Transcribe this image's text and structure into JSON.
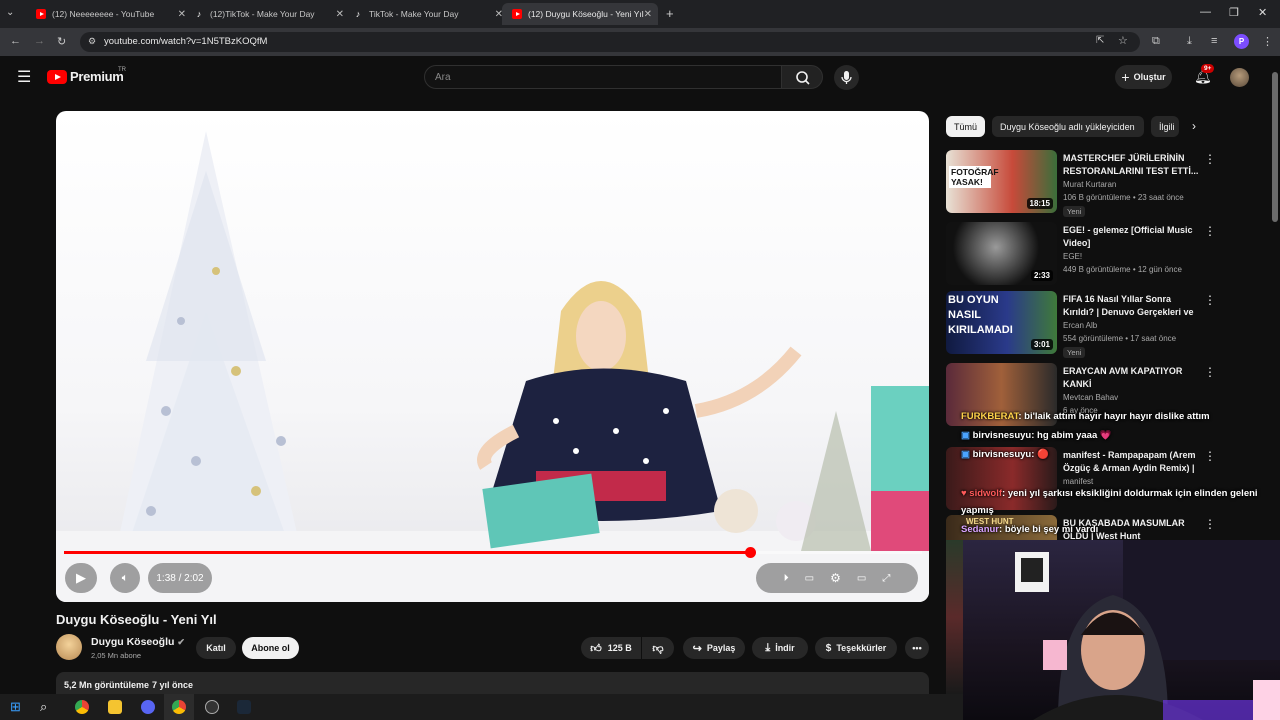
{
  "browser": {
    "tabs": [
      {
        "title": "(12) Neeeeeeee - YouTube",
        "icon": "youtube-icon",
        "active": false
      },
      {
        "title": "(12)TikTok - Make Your Day",
        "icon": "tiktok-icon",
        "active": false
      },
      {
        "title": "TikTok - Make Your Day",
        "icon": "tiktok-icon",
        "active": false
      },
      {
        "title": "(12) Duygu Köseoğlu - Yeni Yıl",
        "icon": "youtube-icon",
        "active": true
      }
    ],
    "url": "youtube.com/watch?v=1N5TBzKOQfM",
    "profile_initial": "P"
  },
  "masthead": {
    "logo_text": "Premium",
    "region": "TR",
    "search_placeholder": "Ara",
    "create_label": "Oluştur",
    "notification_count": "9+"
  },
  "player": {
    "time": "1:38 / 2:02",
    "progress_fraction": 0.8
  },
  "video": {
    "title": "Duygu Köseoğlu - Yeni Yıl",
    "channel": "Duygu Köseoğlu",
    "subscribers": "2,05 Mn abone",
    "join_label": "Katıl",
    "subscribe_label": "Abone ol",
    "likes": "125 B",
    "share_label": "Paylaş",
    "download_label": "İndir",
    "thanks_label": "Teşekkürler",
    "views": "5,2 Mn görüntüleme",
    "age": "7 yıl önce"
  },
  "sidebar": {
    "chips": [
      "Tümü",
      "Duygu Köseoğlu adlı yükleyiciden",
      "İlgili"
    ],
    "items": [
      {
        "title": "MASTERCHEF JÜRİLERİNİN RESTORANLARINI TEST ETTİ...",
        "channel": "Murat Kurtaran",
        "meta": "106 B görüntüleme • 23 saat önce",
        "badge": "Yeni",
        "duration": "18:15",
        "thumb_text": "FOTOĞRAF YASAK!"
      },
      {
        "title": "EGE! - gelemez [Official Music Video]",
        "channel": "EGE!",
        "meta": "449 B görüntüleme • 12 gün önce",
        "badge": "",
        "duration": "2:33",
        "thumb_text": ""
      },
      {
        "title": "FIFA 16 Nasıl Yıllar Sonra Kırıldı? | Denuvo Gerçekleri ve ...",
        "channel": "Ercan Alb",
        "meta": "554 görüntüleme • 17 saat önce",
        "badge": "Yeni",
        "duration": "3:01",
        "thumb_text": "BU OYUN NASIL KIRILAMADI"
      },
      {
        "title": "ERAYCAN AVM KAPATIYOR KANKİ",
        "channel": "Mevtcan Bahav",
        "meta": "6 ay önce",
        "badge": "",
        "duration": "",
        "thumb_text": ""
      },
      {
        "title": "manifest - Rampapapam (Arem Özgüç & Arman Aydin Remix) | ...",
        "channel": "manifest",
        "meta": "",
        "badge": "",
        "duration": "",
        "thumb_text": ""
      },
      {
        "title": "BU KASABADA MASUMLAR ÖLDÜ | West Hunt",
        "channel": "",
        "meta": "",
        "badge": "",
        "duration": "",
        "thumb_text": "WEST HUNT"
      }
    ]
  },
  "chat": [
    {
      "user": "FURKBERAT",
      "text": ": bi'laik attım hayır hayır hayır dislike attım",
      "color": "#ffd24a"
    },
    {
      "user": "birvisnesuyu",
      "text": ": hg abim yaaa 💗",
      "color": "#ffffff"
    },
    {
      "user": "birvisnesuyu",
      "text": ": 🔴",
      "color": "#ffffff"
    },
    {
      "user": "sidwolf",
      "text": ": yeni yıl şarkısı eksikliğini doldurmak için elinden geleni",
      "color": "#ff5a5a"
    },
    {
      "user": "",
      "text": "yapmış",
      "color": "#ffffff"
    },
    {
      "user": "Sedanur",
      "text": ": böyle bi şey mi vardı",
      "color": "#d9a3ff"
    }
  ],
  "colors": {
    "accent": "#ff0000",
    "background": "#0f0f0f",
    "surface": "#272727"
  }
}
